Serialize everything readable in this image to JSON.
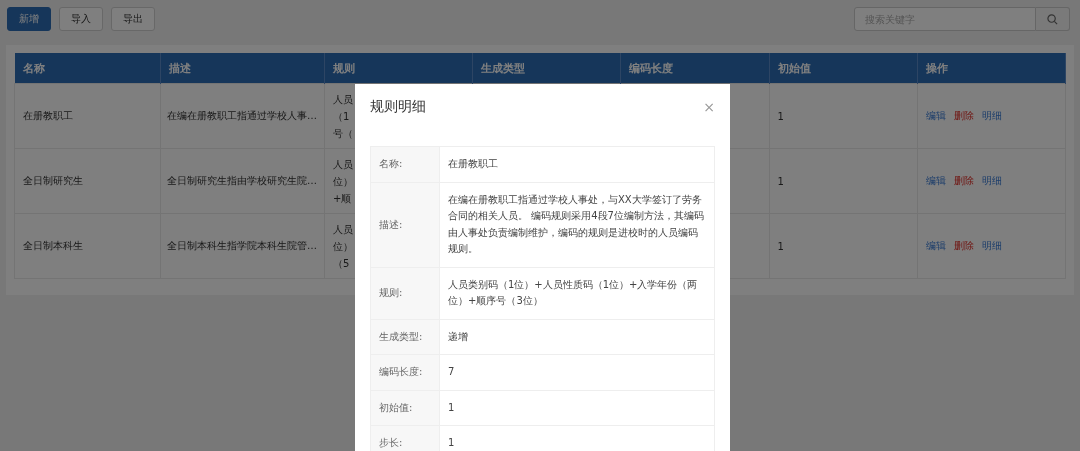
{
  "toolbar": {
    "buttons": [
      {
        "label": "新增",
        "kind": "primary"
      },
      {
        "label": "导入",
        "kind": "default"
      },
      {
        "label": "导出",
        "kind": "default"
      }
    ],
    "search": {
      "placeholder": "搜索关键字"
    }
  },
  "table": {
    "columns": [
      "名称",
      "描述",
      "规则",
      "生成类型",
      "编码长度",
      "初始值",
      "操作"
    ],
    "rows": [
      {
        "name": "在册教职工",
        "description": "在编在册教职工指通过学校人事…",
        "rule_lines": [
          "人员",
          "（1",
          "号（"
        ],
        "initial": "1",
        "actions": [
          {
            "label": "编辑",
            "kind": "edit"
          },
          {
            "label": "删除",
            "kind": "delete"
          },
          {
            "label": "明细",
            "kind": "detail"
          }
        ]
      },
      {
        "name": "全日制研究生",
        "description": "全日制研究生指由学校研究生院…",
        "rule_lines": [
          "人员",
          "位）",
          "+顺"
        ],
        "initial": "1",
        "actions": [
          {
            "label": "编辑",
            "kind": "edit"
          },
          {
            "label": "删除",
            "kind": "delete"
          },
          {
            "label": "明细",
            "kind": "detail"
          }
        ]
      },
      {
        "name": "全日制本科生",
        "description": "全日制本科生指学院本科生院管…",
        "rule_lines": [
          "人员",
          "位）",
          "（5"
        ],
        "initial": "1",
        "actions": [
          {
            "label": "编辑",
            "kind": "edit"
          },
          {
            "label": "删除",
            "kind": "delete"
          },
          {
            "label": "明细",
            "kind": "detail"
          }
        ]
      }
    ]
  },
  "dialog": {
    "title": "规则明细",
    "close": "×",
    "fields": [
      {
        "label": "名称:",
        "value": "在册教职工"
      },
      {
        "label": "描述:",
        "value": "在编在册教职工指通过学校人事处，与XX大学签订了劳务合同的相关人员。 编码规则采用4段7位编制方法，其编码由人事处负责编制维护，编码的规则是进校时的人员编码规则。"
      },
      {
        "label": "规则:",
        "value": "人员类别码（1位）+人员性质码（1位）+入学年份（两位）+顺序号（3位）"
      },
      {
        "label": "生成类型:",
        "value": "递增"
      },
      {
        "label": "编码长度:",
        "value": "7"
      },
      {
        "label": "初始值:",
        "value": "1"
      },
      {
        "label": "步长:",
        "value": "1"
      }
    ]
  }
}
